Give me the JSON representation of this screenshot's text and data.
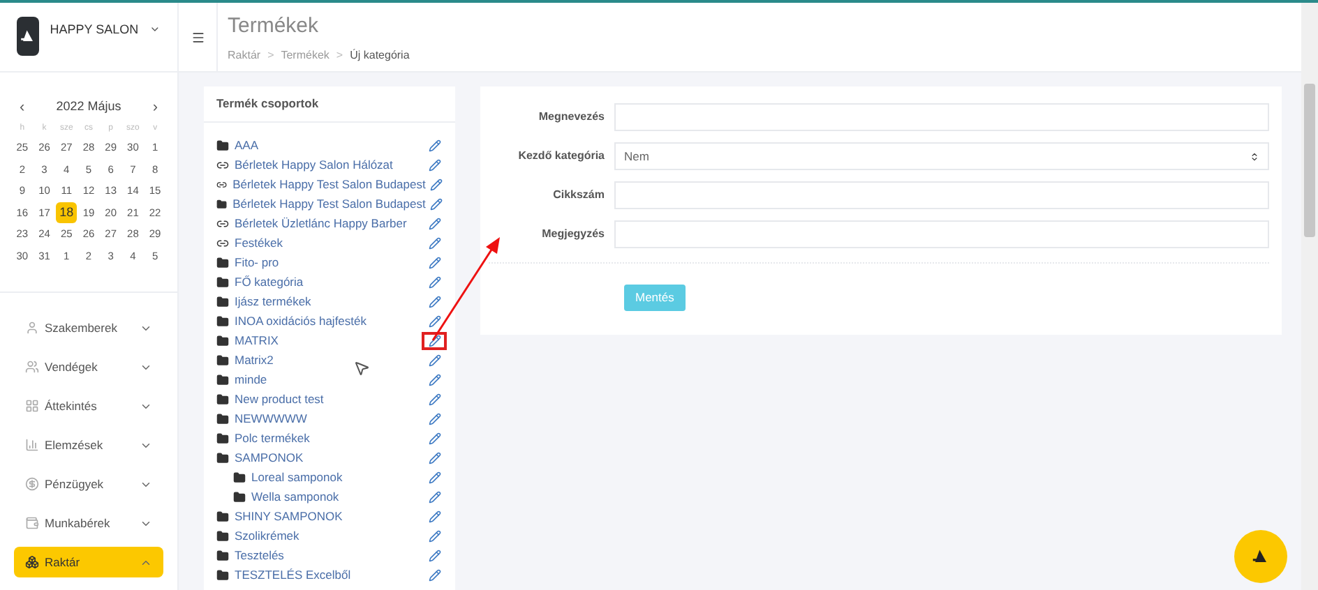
{
  "brand": {
    "name": "HAPPY SALON"
  },
  "header": {
    "title": "Termékek",
    "breadcrumb": [
      "Raktár",
      "Termékek",
      "Új kategória"
    ],
    "separator": ">"
  },
  "calendar": {
    "month": "2022 Május",
    "prev": "‹",
    "next": "›",
    "weekdays": [
      "h",
      "k",
      "sze",
      "cs",
      "p",
      "szo",
      "v"
    ],
    "weeks": [
      [
        {
          "day": "25",
          "selected": false
        },
        {
          "day": "26",
          "selected": false
        },
        {
          "day": "27",
          "selected": false
        },
        {
          "day": "28",
          "selected": false
        },
        {
          "day": "29",
          "selected": false
        },
        {
          "day": "30",
          "selected": false
        },
        {
          "day": "1",
          "selected": false
        }
      ],
      [
        {
          "day": "2",
          "selected": false
        },
        {
          "day": "3",
          "selected": false
        },
        {
          "day": "4",
          "selected": false
        },
        {
          "day": "5",
          "selected": false
        },
        {
          "day": "6",
          "selected": false
        },
        {
          "day": "7",
          "selected": false
        },
        {
          "day": "8",
          "selected": false
        }
      ],
      [
        {
          "day": "9",
          "selected": false
        },
        {
          "day": "10",
          "selected": false
        },
        {
          "day": "11",
          "selected": false
        },
        {
          "day": "12",
          "selected": false
        },
        {
          "day": "13",
          "selected": false
        },
        {
          "day": "14",
          "selected": false
        },
        {
          "day": "15",
          "selected": false
        }
      ],
      [
        {
          "day": "16",
          "selected": false
        },
        {
          "day": "17",
          "selected": false
        },
        {
          "day": "18",
          "selected": true
        },
        {
          "day": "19",
          "selected": false
        },
        {
          "day": "20",
          "selected": false
        },
        {
          "day": "21",
          "selected": false
        },
        {
          "day": "22",
          "selected": false
        }
      ],
      [
        {
          "day": "23",
          "selected": false
        },
        {
          "day": "24",
          "selected": false
        },
        {
          "day": "25",
          "selected": false
        },
        {
          "day": "26",
          "selected": false
        },
        {
          "day": "27",
          "selected": false
        },
        {
          "day": "28",
          "selected": false
        },
        {
          "day": "29",
          "selected": false
        }
      ],
      [
        {
          "day": "30",
          "selected": false
        },
        {
          "day": "31",
          "selected": false
        },
        {
          "day": "1",
          "selected": false
        },
        {
          "day": "2",
          "selected": false
        },
        {
          "day": "3",
          "selected": false
        },
        {
          "day": "4",
          "selected": false
        },
        {
          "day": "5",
          "selected": false
        }
      ]
    ]
  },
  "nav": [
    {
      "label": "Szakemberek",
      "selected": false,
      "expanded": false
    },
    {
      "label": "Vendégek",
      "selected": false,
      "expanded": false
    },
    {
      "label": "Áttekintés",
      "selected": false,
      "expanded": false
    },
    {
      "label": "Elemzések",
      "selected": false,
      "expanded": false
    },
    {
      "label": "Pénzügyek",
      "selected": false,
      "expanded": false
    },
    {
      "label": "Munkabérek",
      "selected": false,
      "expanded": false
    },
    {
      "label": "Raktár",
      "selected": true,
      "expanded": true
    }
  ],
  "groups": {
    "title": "Termék csoportok",
    "items": [
      {
        "label": "AAA",
        "kind": "folder",
        "highlighted": false
      },
      {
        "label": "Bérletek Happy Salon Hálózat",
        "kind": "link",
        "highlighted": false
      },
      {
        "label": "Bérletek Happy Test Salon Budapest",
        "kind": "link",
        "highlighted": false
      },
      {
        "label": "Bérletek Happy Test Salon Budapest",
        "kind": "folder",
        "highlighted": false
      },
      {
        "label": "Bérletek Üzletlánc Happy Barber",
        "kind": "link",
        "highlighted": false
      },
      {
        "label": "Festékek",
        "kind": "link",
        "highlighted": false
      },
      {
        "label": "Fito- pro",
        "kind": "folder",
        "highlighted": false
      },
      {
        "label": "FŐ kategória",
        "kind": "folder",
        "highlighted": false
      },
      {
        "label": "Ijász termékek",
        "kind": "folder",
        "highlighted": false
      },
      {
        "label": "INOA oxidációs hajfesték",
        "kind": "folder",
        "highlighted": false
      },
      {
        "label": "MATRIX",
        "kind": "folder",
        "highlighted": true
      },
      {
        "label": "Matrix2",
        "kind": "folder",
        "highlighted": false
      },
      {
        "label": "minde",
        "kind": "folder",
        "highlighted": false
      },
      {
        "label": "New product test",
        "kind": "folder",
        "highlighted": false
      },
      {
        "label": "NEWWWWW",
        "kind": "folder",
        "highlighted": false
      },
      {
        "label": "Polc termékek",
        "kind": "folder",
        "highlighted": false
      },
      {
        "label": "SAMPONOK",
        "kind": "folder",
        "highlighted": false,
        "children": [
          {
            "label": "Loreal samponok",
            "kind": "folder",
            "highlighted": false
          },
          {
            "label": "Wella samponok",
            "kind": "folder",
            "highlighted": false
          }
        ]
      },
      {
        "label": "SHINY SAMPONOK",
        "kind": "folder",
        "highlighted": false
      },
      {
        "label": "Szolikrémek",
        "kind": "folder",
        "highlighted": false
      },
      {
        "label": "Tesztelés",
        "kind": "folder",
        "highlighted": false
      },
      {
        "label": "TESZTELÉS Excelből",
        "kind": "folder",
        "highlighted": false
      }
    ]
  },
  "form": {
    "fields": [
      {
        "label": "Megnevezés",
        "kind": "text"
      },
      {
        "label": "Kezdő kategória",
        "kind": "select",
        "value": "Nem"
      },
      {
        "label": "Cikkszám",
        "kind": "text"
      },
      {
        "label": "Megjegyzés",
        "kind": "text"
      }
    ],
    "submit": "Mentés"
  }
}
